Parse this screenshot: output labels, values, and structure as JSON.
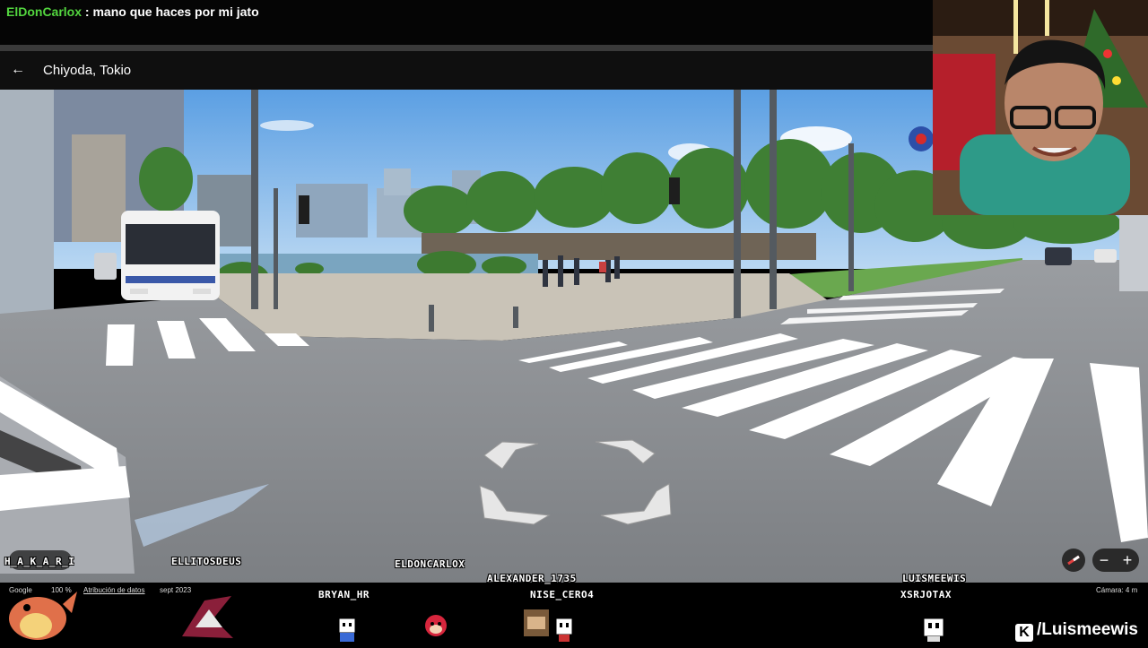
{
  "chat": {
    "username": "ElDonCarlox",
    "separator": " : ",
    "message": "mano que haces por mi jato"
  },
  "header": {
    "back_icon": "arrow-left-icon",
    "title": "Chiyoda, Tokio"
  },
  "controls": {
    "zoom_out": "−",
    "zoom_in": "+",
    "compass_icon": "compass-icon"
  },
  "attribution": {
    "google": "Google",
    "zoom_level": "100 %",
    "data_attribution": "Atribución de datos",
    "date": "sept 2023",
    "camera": "Cámara: 4 m"
  },
  "overlay_names": {
    "hakari": "H_A_K_A_R_I",
    "ellitosdeus": "ELLITOSDEUS",
    "eldoncarlox": "ELDONCARLOX",
    "alexander": "ALEXANDER_1735",
    "luismeewis": "LUISMEEWIS",
    "bryan": "BRYAN_HR",
    "nise": "NISE_CERO4",
    "xsrjotax": "XSRJOTAX"
  },
  "branding": {
    "platform_icon": "kick-logo-icon",
    "handle": "/Luismeewis"
  },
  "colors": {
    "chat_username": "#53d63f",
    "sky": "#7fb6ea",
    "grass": "#6aa84f",
    "road": "#8a8d91"
  }
}
